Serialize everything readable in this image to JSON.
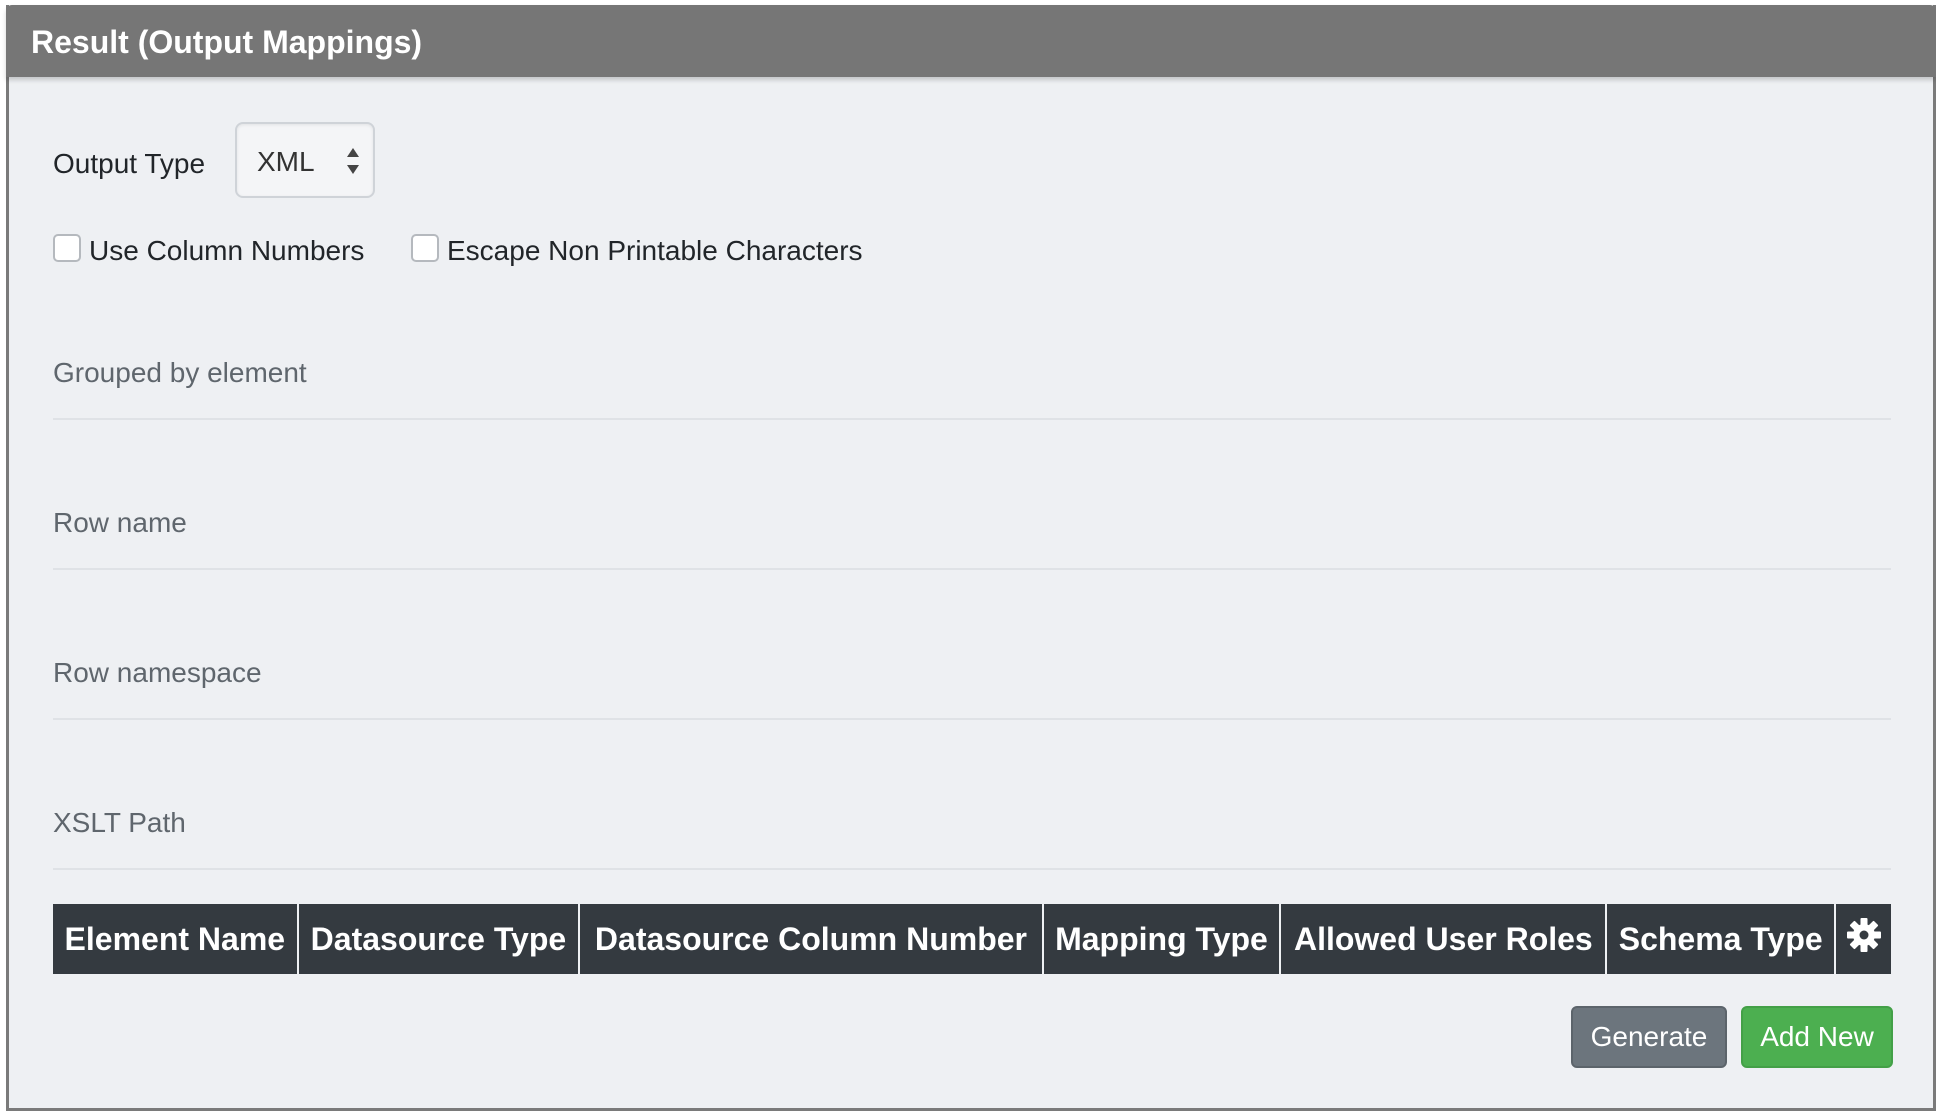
{
  "panel": {
    "title": "Result (Output Mappings)"
  },
  "output_type": {
    "label": "Output Type",
    "selected": "XML"
  },
  "checkboxes": [
    {
      "label": "Use Column Numbers",
      "checked": false
    },
    {
      "label": "Escape Non Printable Characters",
      "checked": false
    }
  ],
  "fields": [
    {
      "placeholder": "Grouped by element",
      "value": ""
    },
    {
      "placeholder": "Row name",
      "value": ""
    },
    {
      "placeholder": "Row namespace",
      "value": ""
    },
    {
      "placeholder": "XSLT Path",
      "value": ""
    }
  ],
  "table": {
    "columns": [
      "Element Name",
      "Datasource Type",
      "Datasource Column Number",
      "Mapping Type",
      "Allowed User Roles",
      "Schema Type"
    ],
    "settings_icon": "gear-icon",
    "rows": []
  },
  "buttons": {
    "generate": "Generate",
    "add_new": "Add New"
  },
  "colors": {
    "header": "#767676",
    "table_header": "#343a40",
    "generate": "#6c757d",
    "add_new": "#4caf50"
  }
}
